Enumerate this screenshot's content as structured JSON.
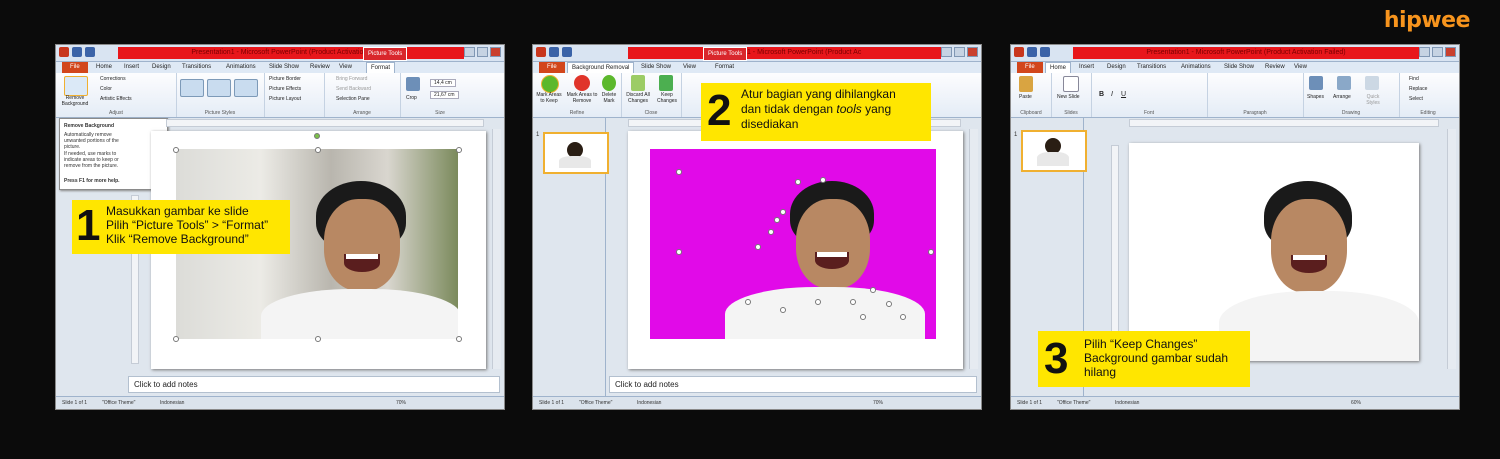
{
  "brand": {
    "logo_text": "hipwee",
    "logo_color": "#f7941d"
  },
  "colors": {
    "callout": "#ffe600",
    "title_red": "#e8161b",
    "file_tab": "#d2461c",
    "magenta": "#e10ae8"
  },
  "panel1": {
    "title": "Presentation1 - Microsoft PowerPoint (Product Activation Failed)",
    "context_tab": "Picture Tools",
    "tabs": [
      "File",
      "Home",
      "Insert",
      "Design",
      "Transitions",
      "Animations",
      "Slide Show",
      "Review",
      "View",
      "Format"
    ],
    "ribbon": {
      "remove_bg": "Remove Background",
      "corrections": "Corrections",
      "color": "Color",
      "artistic": "Artistic Effects",
      "adjust": "Adjust",
      "picture_styles": "Picture Styles",
      "border": "Picture Border",
      "effects": "Picture Effects",
      "layout": "Picture Layout",
      "bring_forward": "Bring Forward",
      "send_backward": "Send Backward",
      "selection_pane": "Selection Pane",
      "arrange": "Arrange",
      "crop": "Crop",
      "height": "14,4 cm",
      "width": "21,67 cm",
      "size": "Size"
    },
    "tooltip": {
      "title": "Remove Background",
      "line1": "Automatically remove unwanted portions of the picture.",
      "line2": "If needed, use marks to indicate areas to keep or remove from the picture.",
      "help": "Press F1 for more help."
    },
    "callout": {
      "number": "1",
      "line1": "Masukkan gambar ke slide",
      "line2": "Pilih “Picture Tools” > “Format”",
      "line3": "Klik “Remove Background”"
    },
    "notes": "Click to add notes",
    "status": {
      "slide": "Slide 1 of 1",
      "theme": "\"Office Theme\"",
      "lang": "Indonesian",
      "zoom": "70%"
    }
  },
  "panel2": {
    "title": "Presentation1 - Microsoft PowerPoint (Product Ac",
    "context_tab": "Picture Tools",
    "tabs": [
      "File",
      "Background Removal",
      "Slide Show",
      "View",
      "Format"
    ],
    "ribbon": {
      "mark_keep": "Mark Areas to Keep",
      "mark_remove": "Mark Areas to Remove",
      "delete_mark": "Delete Mark",
      "discard": "Discard All Changes",
      "keep": "Keep Changes",
      "refine": "Refine",
      "close": "Close"
    },
    "callout": {
      "number": "2",
      "line1": "Atur bagian yang dihilangkan",
      "line2_a": "dan tidak dengan ",
      "line2_b": "tools",
      "line2_c": " yang",
      "line3": "disediakan"
    },
    "notes": "Click to add notes",
    "status": {
      "slide": "Slide 1 of 1",
      "theme": "\"Office Theme\"",
      "lang": "Indonesian",
      "zoom": "70%"
    }
  },
  "panel3": {
    "title": "Presentation1 - Microsoft PowerPoint (Product Activation Failed)",
    "tabs": [
      "File",
      "Home",
      "Insert",
      "Design",
      "Transitions",
      "Animations",
      "Slide Show",
      "Review",
      "View"
    ],
    "ribbon": {
      "paste": "Paste",
      "new_slide": "New Slide",
      "shapes": "Shapes",
      "arrange": "Arrange",
      "quick_styles": "Quick Styles",
      "find": "Find",
      "replace": "Replace",
      "select": "Select",
      "clipboard": "Clipboard",
      "slides": "Slides",
      "font": "Font",
      "paragraph": "Paragraph",
      "drawing": "Drawing",
      "editing": "Editing"
    },
    "callout": {
      "number": "3",
      "line1": "Pilih “Keep Changes”",
      "line2": "Background gambar sudah",
      "line3": "hilang"
    },
    "status": {
      "slide": "Slide 1 of 1",
      "theme": "\"Office Theme\"",
      "lang": "Indonesian",
      "zoom": "60%"
    }
  }
}
